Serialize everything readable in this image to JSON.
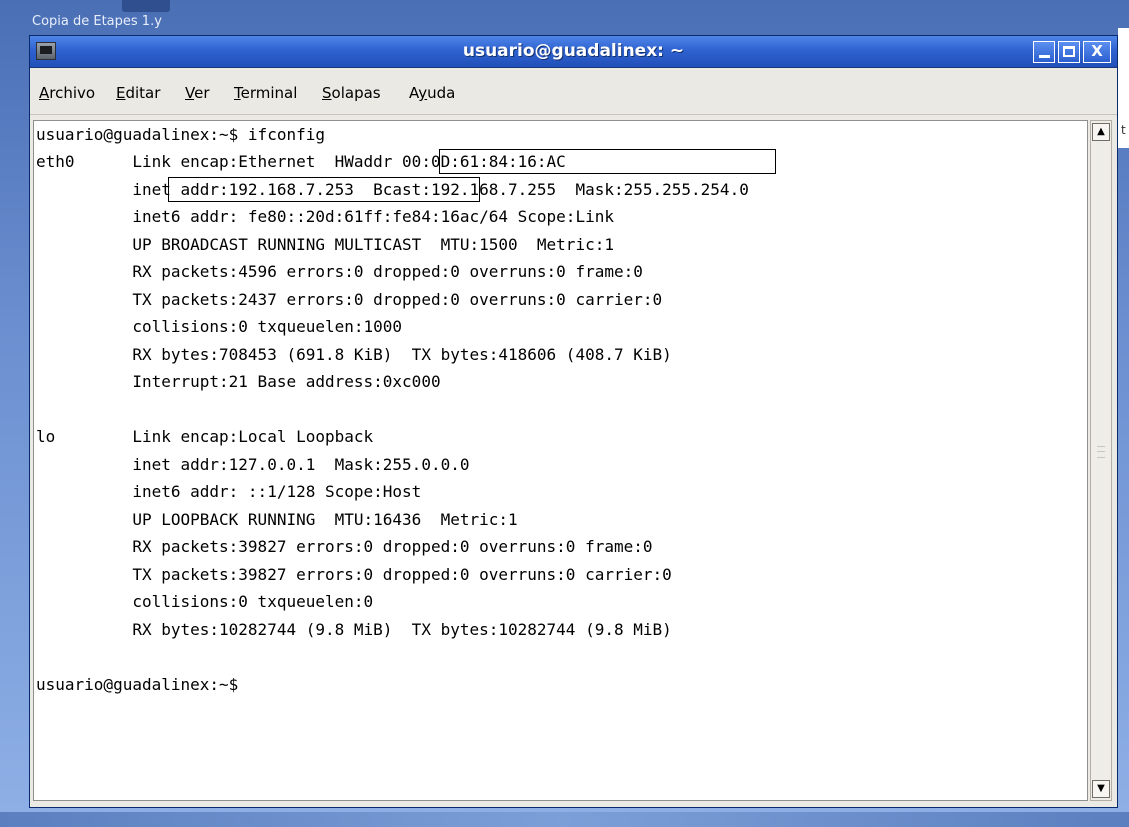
{
  "desktop": {
    "background_label": "Copia de Etapes 1.y",
    "right_peek_char": "t"
  },
  "window": {
    "title": "usuario@guadalinex: ~",
    "buttons": {
      "minimize": "_",
      "maximize": "□",
      "close": "X"
    }
  },
  "menu": {
    "items": [
      {
        "label": "Archivo",
        "accel": "A"
      },
      {
        "label": "Editar",
        "accel": "E"
      },
      {
        "label": "Ver",
        "accel": "V"
      },
      {
        "label": "Terminal",
        "accel": "T"
      },
      {
        "label": "Solapas",
        "accel": "S"
      },
      {
        "label": "Ayuda",
        "accel": "y"
      }
    ]
  },
  "terminal": {
    "lines": [
      "usuario@guadalinex:~$ ifconfig",
      "eth0      Link encap:Ethernet  HWaddr 00:0D:61:84:16:AC",
      "          inet addr:192.168.7.253  Bcast:192.168.7.255  Mask:255.255.254.0",
      "          inet6 addr: fe80::20d:61ff:fe84:16ac/64 Scope:Link",
      "          UP BROADCAST RUNNING MULTICAST  MTU:1500  Metric:1",
      "          RX packets:4596 errors:0 dropped:0 overruns:0 frame:0",
      "          TX packets:2437 errors:0 dropped:0 overruns:0 carrier:0",
      "          collisions:0 txqueuelen:1000",
      "          RX bytes:708453 (691.8 KiB)  TX bytes:418606 (408.7 KiB)",
      "          Interrupt:21 Base address:0xc000",
      "",
      "lo        Link encap:Local Loopback",
      "          inet addr:127.0.0.1  Mask:255.0.0.0",
      "          inet6 addr: ::1/128 Scope:Host",
      "          UP LOOPBACK RUNNING  MTU:16436  Metric:1",
      "          RX packets:39827 errors:0 dropped:0 overruns:0 frame:0",
      "          TX packets:39827 errors:0 dropped:0 overruns:0 carrier:0",
      "          collisions:0 txqueuelen:0",
      "          RX bytes:10282744 (9.8 MiB)  TX bytes:10282744 (9.8 MiB)",
      "",
      "usuario@guadalinex:~$"
    ],
    "highlights": [
      {
        "text": "HWaddr 00:0D:61:84:16:AC"
      },
      {
        "text": "inet addr:192.168.7.253"
      }
    ]
  },
  "scrollbar": {
    "up_icon": "▲",
    "down_icon": "▼"
  },
  "colors": {
    "titlebar": "#2f63d1",
    "terminal_bg": "#ffffff",
    "terminal_fg": "#000000",
    "chrome": "#ebe9e3"
  }
}
